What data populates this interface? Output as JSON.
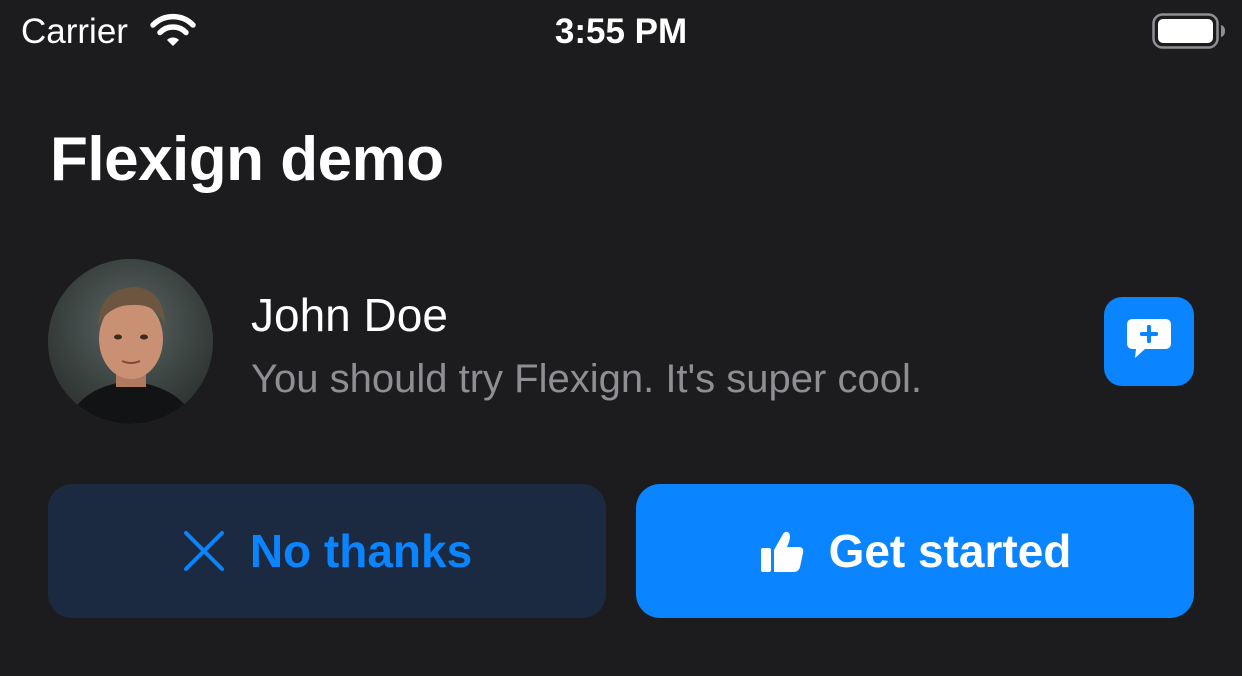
{
  "status_bar": {
    "carrier": "Carrier",
    "time": "3:55 PM",
    "wifi_icon": "wifi-icon",
    "battery_icon": "battery-icon"
  },
  "page": {
    "title": "Flexign demo"
  },
  "post": {
    "author": "John Doe",
    "message": "You should try Flexign. It's super cool.",
    "avatar_icon": "avatar",
    "action_icon": "add-comment-icon"
  },
  "actions": {
    "dismiss_label": "No thanks",
    "dismiss_icon": "close-icon",
    "confirm_label": "Get started",
    "confirm_icon": "thumbs-up-icon"
  },
  "colors": {
    "background": "#1c1c1e",
    "accent": "#0a84ff",
    "secondary_button": "#1b2a40",
    "secondary_text": "#8e8e93"
  }
}
